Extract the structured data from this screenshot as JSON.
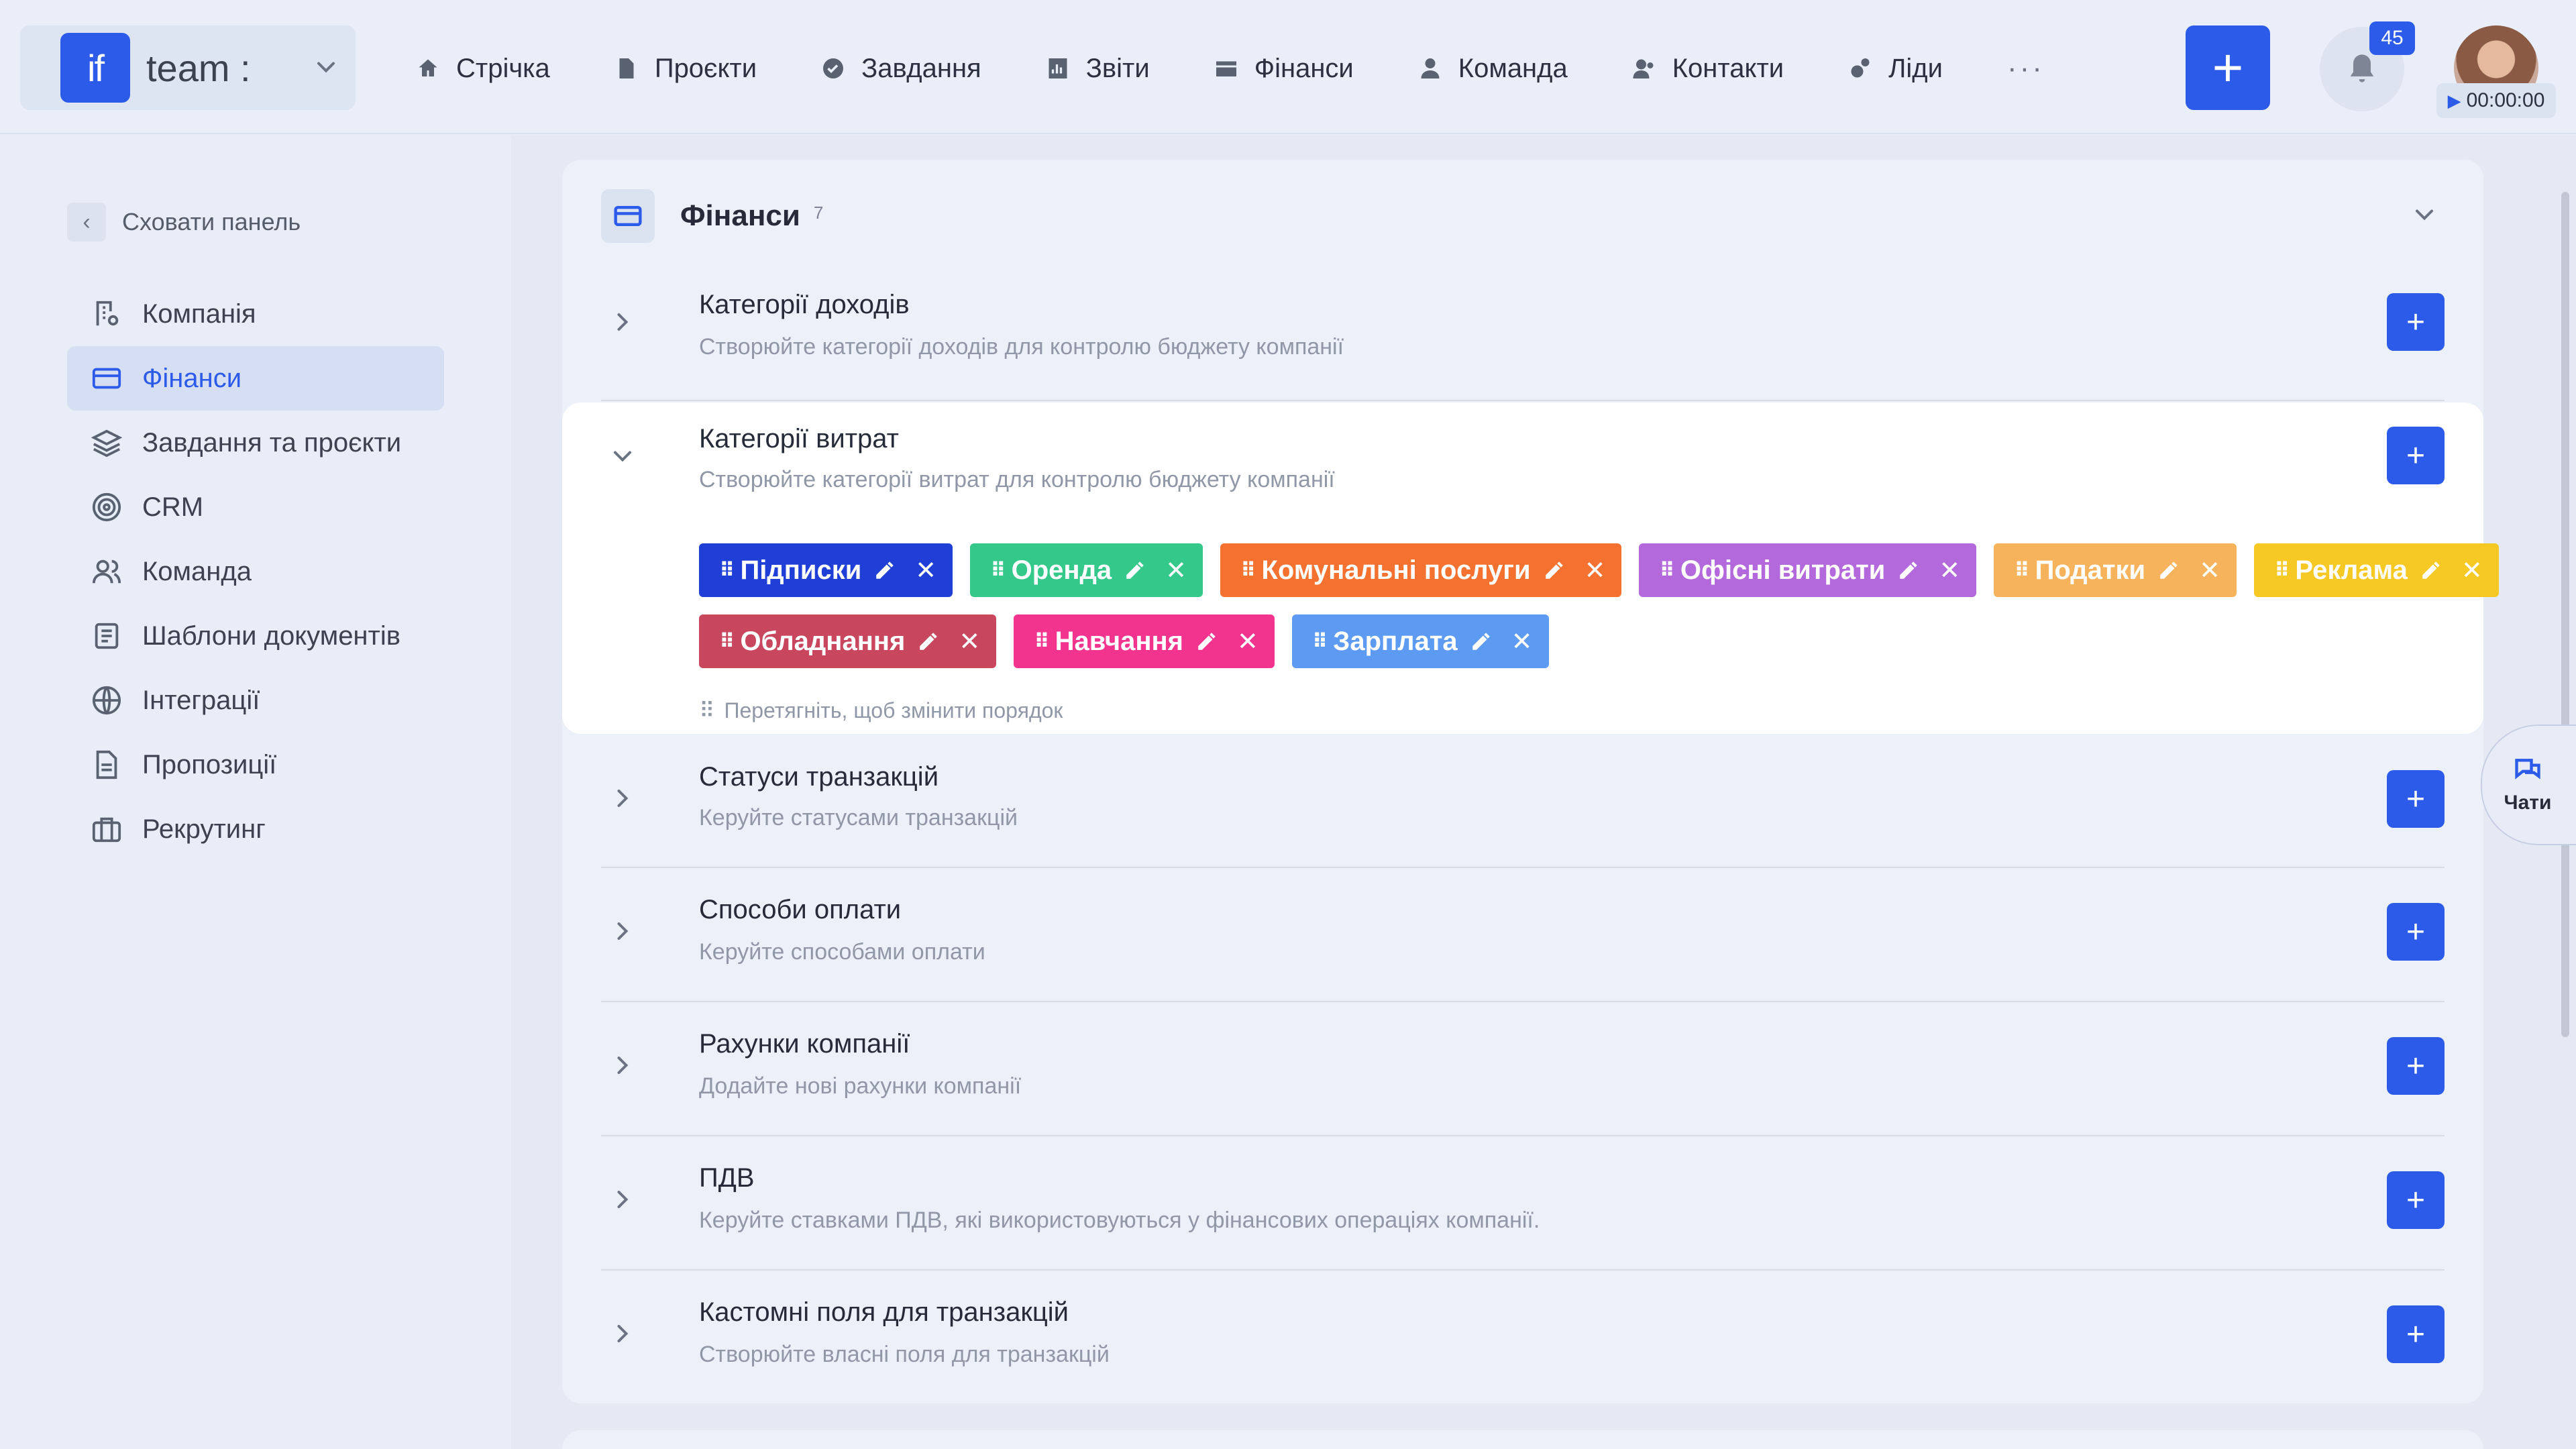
{
  "topbar": {
    "logo_text": "if",
    "team_name": "team :",
    "nav": [
      {
        "label": "Стрічка",
        "icon": "home-icon"
      },
      {
        "label": "Проєкти",
        "icon": "document-icon"
      },
      {
        "label": "Завдання",
        "icon": "check-circle-icon"
      },
      {
        "label": "Звіти",
        "icon": "report-icon"
      },
      {
        "label": "Фінанси",
        "icon": "wallet-icon"
      },
      {
        "label": "Команда",
        "icon": "user-icon"
      },
      {
        "label": "Контакти",
        "icon": "contacts-icon"
      },
      {
        "label": "Ліди",
        "icon": "leads-icon"
      }
    ],
    "more_label": "···",
    "add_label": "+",
    "notification_count": "45",
    "timer": "00:00:00"
  },
  "sidebar": {
    "hide_label": "Сховати панель",
    "items": [
      {
        "label": "Компанія",
        "icon": "company-icon"
      },
      {
        "label": "Фінанси",
        "icon": "card-icon"
      },
      {
        "label": "Завдання та проєкти",
        "icon": "layers-icon"
      },
      {
        "label": "CRM",
        "icon": "target-icon"
      },
      {
        "label": "Команда",
        "icon": "team-icon"
      },
      {
        "label": "Шаблони документів",
        "icon": "template-icon"
      },
      {
        "label": "Інтеграції",
        "icon": "globe-icon"
      },
      {
        "label": "Пропозиції",
        "icon": "file-icon"
      },
      {
        "label": "Рекрутинг",
        "icon": "briefcase-icon"
      }
    ],
    "active_index": 1
  },
  "card": {
    "title": "Фінанси",
    "count": "7",
    "sections": [
      {
        "title": "Категорії доходів",
        "subtitle": "Створюйте категорії доходів для контролю бюджету компанії"
      },
      {
        "title": "Категорії витрат",
        "subtitle": "Створюйте категорії витрат для контролю бюджету компанії"
      },
      {
        "title": "Статуси транзакцій",
        "subtitle": "Керуйте статусами транзакцій"
      },
      {
        "title": "Способи оплати",
        "subtitle": "Керуйте способами оплати"
      },
      {
        "title": "Рахунки компанії",
        "subtitle": "Додайте нові рахунки компанії"
      },
      {
        "title": "ПДВ",
        "subtitle": "Керуйте ставками ПДВ, які використовуються у фінансових операціях компанії."
      },
      {
        "title": "Кастомні поля для транзакцій",
        "subtitle": "Створюйте власні поля для транзакцій"
      }
    ],
    "expense_tags": [
      {
        "label": "Підписки",
        "color": "#1f3fd6"
      },
      {
        "label": "Оренда",
        "color": "#34c98a"
      },
      {
        "label": "Комунальні послуги",
        "color": "#f4712f"
      },
      {
        "label": "Офісні витрати",
        "color": "#b368dc"
      },
      {
        "label": "Податки",
        "color": "#f7b35b"
      },
      {
        "label": "Реклама",
        "color": "#f6c824"
      },
      {
        "label": "Обладнання",
        "color": "#c8475f"
      },
      {
        "label": "Навчання",
        "color": "#f2348f"
      },
      {
        "label": "Зарплата",
        "color": "#5d9bf2"
      }
    ],
    "drag_hint": "Перетягніть, щоб змінити порядок"
  },
  "chat_fab": {
    "label": "Чати"
  },
  "colors": {
    "accent": "#2c5ae9",
    "background": "#e8edf7"
  }
}
